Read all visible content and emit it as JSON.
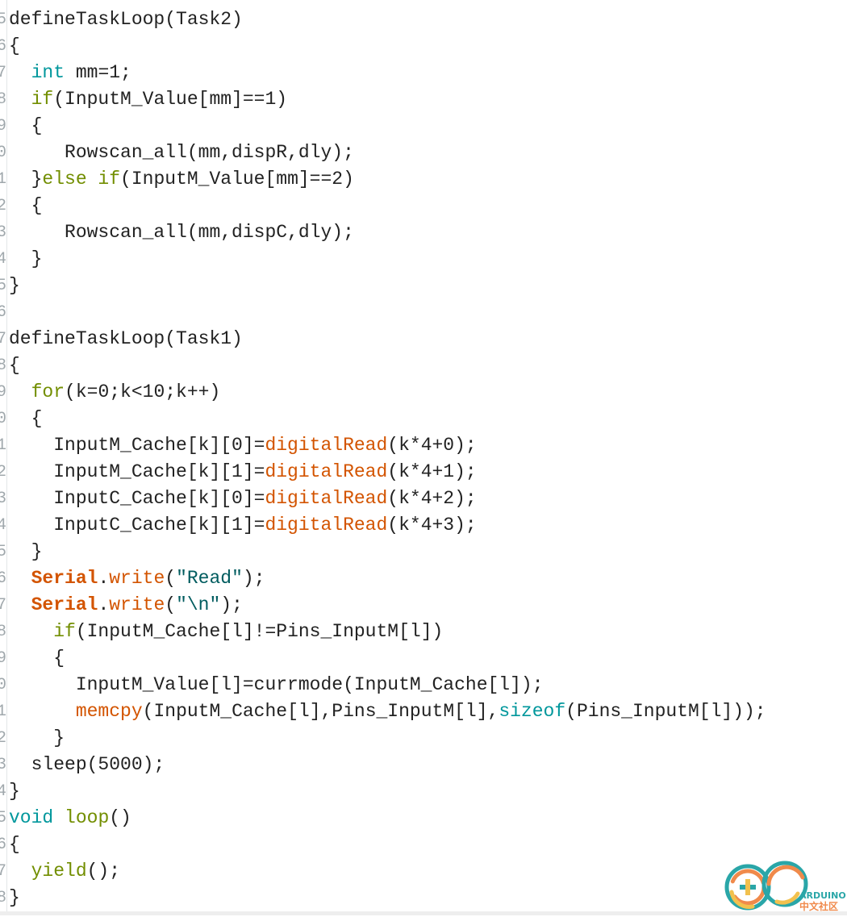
{
  "editor": {
    "line_numbers": [
      "5",
      "6",
      "7",
      "8",
      "9",
      "0",
      "1",
      "2",
      "3",
      "4",
      "5",
      "6",
      "7",
      "8",
      "9",
      "0",
      "1",
      "2",
      "3",
      "4",
      "5",
      "6",
      "7",
      "8",
      "9",
      "0",
      "1",
      "2",
      "3",
      "4",
      "5",
      "6",
      "7",
      "8"
    ],
    "lines": [
      [
        [
          "defineTaskLoop(Task2)",
          "plain"
        ]
      ],
      [
        [
          "{",
          "plain"
        ]
      ],
      [
        [
          "  ",
          "plain"
        ],
        [
          "int",
          "kw-type"
        ],
        [
          " mm=1;",
          "plain"
        ]
      ],
      [
        [
          "  ",
          "plain"
        ],
        [
          "if",
          "kw-ctrl"
        ],
        [
          "(InputM_Value[mm]==1)",
          "plain"
        ]
      ],
      [
        [
          "  {",
          "plain"
        ]
      ],
      [
        [
          "     Rowscan_all(mm,dispR,dly);",
          "plain"
        ]
      ],
      [
        [
          "  }",
          "plain"
        ],
        [
          "else if",
          "kw-ctrl"
        ],
        [
          "(InputM_Value[mm]==2)",
          "plain"
        ]
      ],
      [
        [
          "  {",
          "plain"
        ]
      ],
      [
        [
          "     Rowscan_all(mm,dispC,dly);",
          "plain"
        ]
      ],
      [
        [
          "  }",
          "plain"
        ]
      ],
      [
        [
          "}",
          "plain"
        ]
      ],
      [
        [
          "",
          "plain"
        ]
      ],
      [
        [
          "defineTaskLoop(Task1)",
          "plain"
        ]
      ],
      [
        [
          "{",
          "plain"
        ]
      ],
      [
        [
          "  ",
          "plain"
        ],
        [
          "for",
          "kw-ctrl"
        ],
        [
          "(k=0;k<10;k++)",
          "plain"
        ]
      ],
      [
        [
          "  {",
          "plain"
        ]
      ],
      [
        [
          "    InputM_Cache[k][0]=",
          "plain"
        ],
        [
          "digitalRead",
          "fn"
        ],
        [
          "(k*4+0);",
          "plain"
        ]
      ],
      [
        [
          "    InputM_Cache[k][1]=",
          "plain"
        ],
        [
          "digitalRead",
          "fn"
        ],
        [
          "(k*4+1);",
          "plain"
        ]
      ],
      [
        [
          "    InputC_Cache[k][0]=",
          "plain"
        ],
        [
          "digitalRead",
          "fn"
        ],
        [
          "(k*4+2);",
          "plain"
        ]
      ],
      [
        [
          "    InputC_Cache[k][1]=",
          "plain"
        ],
        [
          "digitalRead",
          "fn"
        ],
        [
          "(k*4+3);",
          "plain"
        ]
      ],
      [
        [
          "  }",
          "plain"
        ]
      ],
      [
        [
          "  ",
          "plain"
        ],
        [
          "Serial",
          "cls"
        ],
        [
          ".",
          "plain"
        ],
        [
          "write",
          "fn"
        ],
        [
          "(",
          "plain"
        ],
        [
          "\"Read\"",
          "str"
        ],
        [
          ");",
          "plain"
        ]
      ],
      [
        [
          "  ",
          "plain"
        ],
        [
          "Serial",
          "cls"
        ],
        [
          ".",
          "plain"
        ],
        [
          "write",
          "fn"
        ],
        [
          "(",
          "plain"
        ],
        [
          "\"\\n\"",
          "str"
        ],
        [
          ");",
          "plain"
        ]
      ],
      [
        [
          "    ",
          "plain"
        ],
        [
          "if",
          "kw-ctrl"
        ],
        [
          "(InputM_Cache[l]!=Pins_InputM[l])",
          "plain"
        ]
      ],
      [
        [
          "    {",
          "plain"
        ]
      ],
      [
        [
          "      InputM_Value[l]=currmode(InputM_Cache[l]);",
          "plain"
        ]
      ],
      [
        [
          "      ",
          "plain"
        ],
        [
          "memcpy",
          "fn"
        ],
        [
          "(InputM_Cache[l],Pins_InputM[l],",
          "plain"
        ],
        [
          "sizeof",
          "kw-type"
        ],
        [
          "(Pins_InputM[l]));",
          "plain"
        ]
      ],
      [
        [
          "    }",
          "plain"
        ]
      ],
      [
        [
          "  sleep(5000);",
          "plain"
        ]
      ],
      [
        [
          "}",
          "plain"
        ]
      ],
      [
        [
          "void",
          "kw-type"
        ],
        [
          " ",
          "plain"
        ],
        [
          "loop",
          "kw-ctrl"
        ],
        [
          "()",
          "plain"
        ]
      ],
      [
        [
          "{",
          "plain"
        ]
      ],
      [
        [
          "  ",
          "plain"
        ],
        [
          "yield",
          "kw-ctrl"
        ],
        [
          "();",
          "plain"
        ]
      ],
      [
        [
          "}",
          "plain"
        ]
      ]
    ]
  },
  "logo": {
    "text_top": "ARDUINO",
    "text_bottom": "中文社区"
  },
  "colors": {
    "keyword_type": "#00979c",
    "keyword_control": "#728e00",
    "function": "#d35400",
    "string": "#005c5f"
  }
}
